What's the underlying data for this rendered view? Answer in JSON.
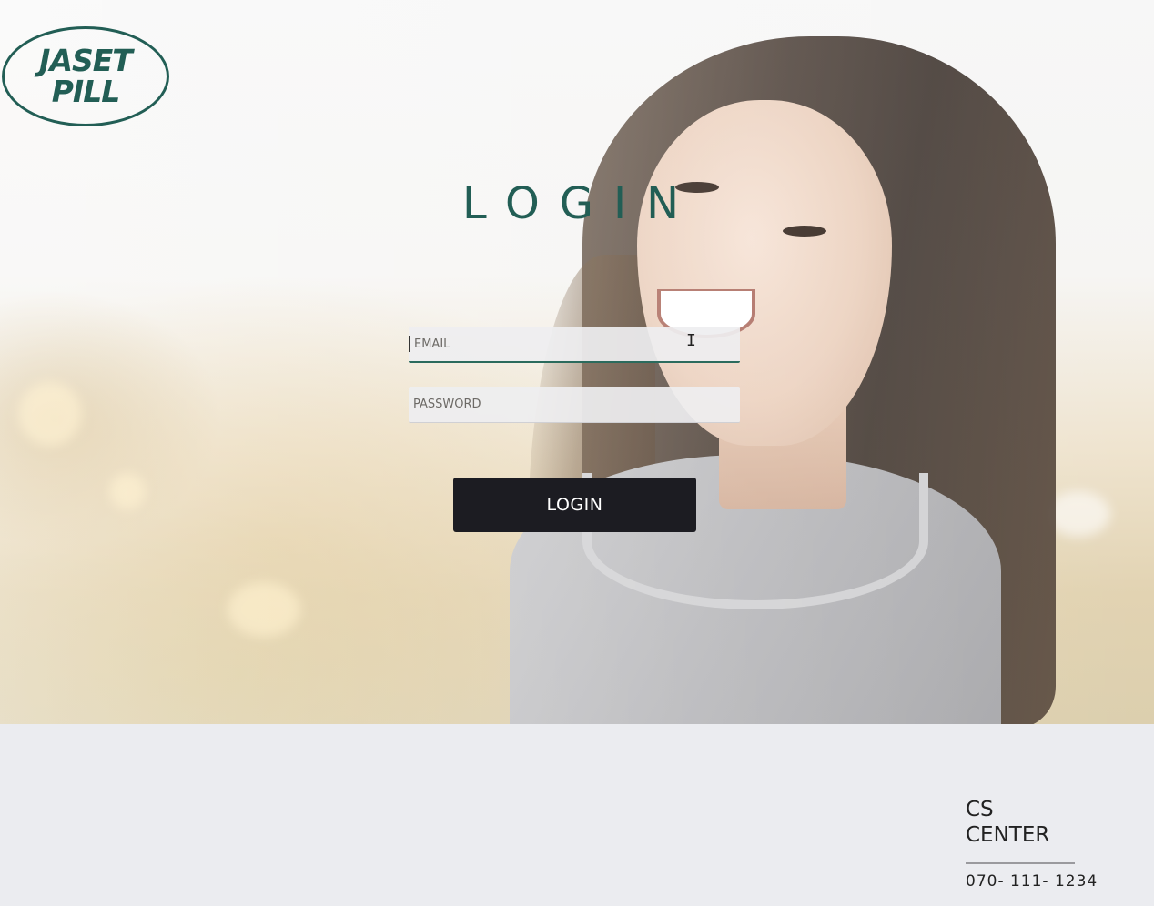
{
  "header": {
    "logo": {
      "line1": "JASET",
      "line2": "PILL"
    }
  },
  "login": {
    "title": "LOGIN",
    "email_placeholder": "EMAIL",
    "password_placeholder": "PASSWORD",
    "button_label": "LOGIN"
  },
  "footer": {
    "cs_line1": "CS",
    "cs_line2": "CENTER",
    "phone": "070- 111- 1234"
  },
  "colors": {
    "brand": "#225e55",
    "button": "#1c1c22",
    "footer_bg": "#ebecf0"
  },
  "icons": {
    "cursor": "text-cursor-icon"
  }
}
